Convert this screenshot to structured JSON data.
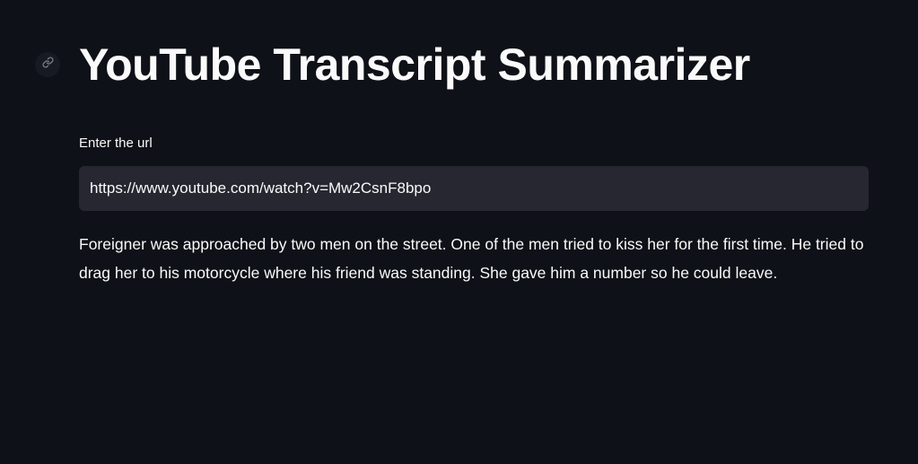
{
  "header": {
    "title": "YouTube Transcript Summarizer",
    "anchor_icon": "link-icon"
  },
  "form": {
    "url_label": "Enter the url",
    "url_value": "https://www.youtube.com/watch?v=Mw2CsnF8bpo"
  },
  "result": {
    "summary": "Foreigner was approached by two men on the street. One of the men tried to kiss her for the first time. He tried to drag her to his motorcycle where his friend was standing. She gave him a number so he could leave."
  },
  "colors": {
    "background": "#0e1117",
    "text": "#fafafa",
    "input_background": "#262730"
  }
}
